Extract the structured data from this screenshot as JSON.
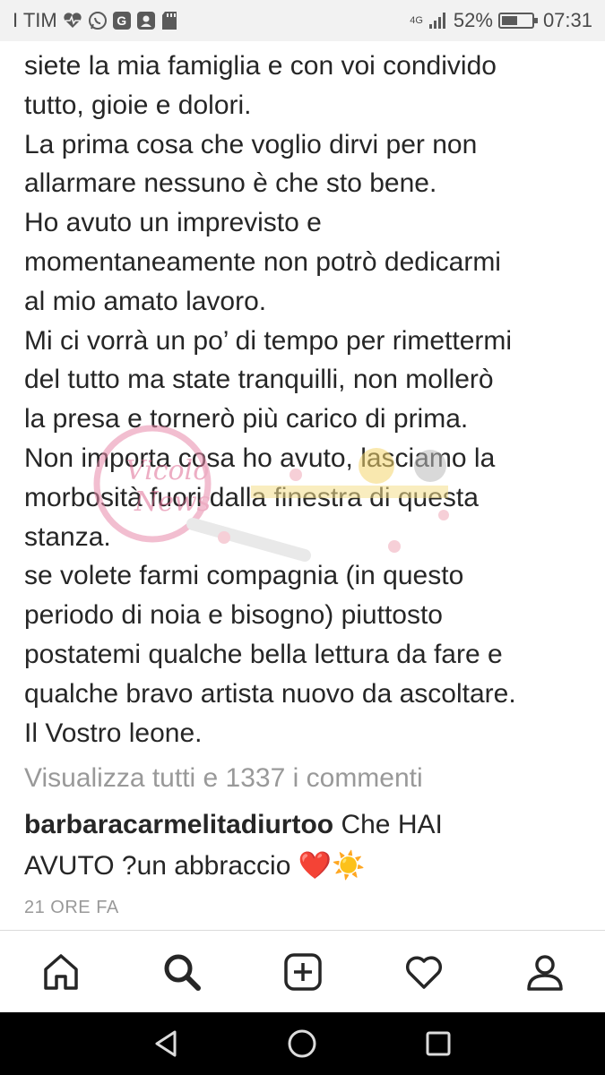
{
  "status_bar": {
    "carrier": "I TIM",
    "network": "4G",
    "battery": "52%",
    "battery_level": 0.52,
    "time": "07:31",
    "icons": [
      "heart-pulse-icon",
      "whatsapp-icon",
      "google-icon",
      "contacts-icon",
      "sd-card-icon",
      "signal-icon",
      "battery-icon"
    ]
  },
  "caption": {
    "lines": [
      "siete la mia famiglia e con voi condivido",
      "tutto, gioie e dolori.",
      "La prima cosa che voglio dirvi per non",
      "allarmare nessuno è che sto bene.",
      "Ho avuto un imprevisto e",
      "momentaneamente non potrò dedicarmi",
      "al mio amato lavoro.",
      "Mi ci vorrà un po’ di tempo per rimettermi",
      "del tutto ma state tranquilli, non mollerò",
      "la presa e tornerò più carico di prima.",
      "Non importa cosa ho avuto, lasciamo la",
      "morbosità fuori dalla finestra di questa",
      "stanza.",
      "se volete farmi compagnia (in questo",
      "periodo di noia e bisogno) piuttosto",
      "postatemi qualche bella lettura da fare e",
      "qualche bravo artista nuovo da ascoltare.",
      "Il Vostro leone."
    ]
  },
  "watermark": {
    "text": "Vicolo News"
  },
  "comments": {
    "view_all": "Visualizza tutti e 1337 i commenti",
    "first": {
      "user": "barbaracarmelitadiurtoo",
      "text_line1": "Che HAI",
      "text_line2": "AVUTO ?un abbraccio ❤️☀️"
    },
    "timestamp": "21 ORE FA"
  },
  "bottom_nav": {
    "items": [
      {
        "icon": "home-icon"
      },
      {
        "icon": "search-icon",
        "active": true
      },
      {
        "icon": "add-post-icon"
      },
      {
        "icon": "heart-icon"
      },
      {
        "icon": "profile-icon"
      }
    ]
  },
  "android_nav": {
    "items": [
      "back-icon",
      "home-circle-icon",
      "recents-icon"
    ]
  }
}
